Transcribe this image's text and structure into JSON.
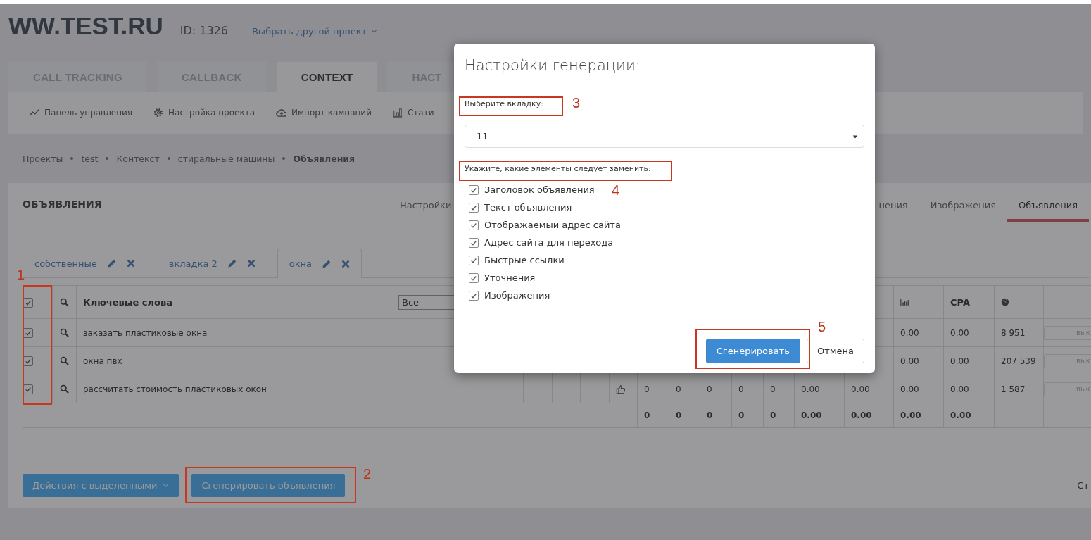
{
  "header": {
    "logo": "WW.TEST.RU",
    "project_id": "ID: 1326",
    "switch_project": "Выбрать другой проект"
  },
  "main_tabs": [
    {
      "label": "CALL TRACKING",
      "selected": false
    },
    {
      "label": "CALLBACK",
      "selected": false
    },
    {
      "label": "CONTEXT",
      "selected": true
    },
    {
      "label": "НАСТ",
      "selected": false
    }
  ],
  "sub_nav": [
    {
      "label": "Панель управления"
    },
    {
      "label": "Настройка проекта"
    },
    {
      "label": "Импорт кампаний"
    },
    {
      "label": "Стати"
    }
  ],
  "breadcrumbs": [
    {
      "label": "Проекты",
      "current": false
    },
    {
      "label": "test",
      "current": false
    },
    {
      "label": "Контекст",
      "current": false
    },
    {
      "label": "стиральные машины",
      "current": false
    },
    {
      "label": "Объявления",
      "current": true
    }
  ],
  "section": {
    "title": "ОБЪЯВЛЕНИЯ",
    "tabs": [
      {
        "label": "Настройки",
        "selected": false
      },
      {
        "label": "нения",
        "selected": false
      },
      {
        "label": "Изображения",
        "selected": false
      },
      {
        "label": "Объявления",
        "selected": true
      }
    ]
  },
  "ad_tabs": [
    {
      "label": "собственные",
      "selected": false
    },
    {
      "label": "вкладка 2",
      "selected": false
    },
    {
      "label": "окна",
      "selected": true
    }
  ],
  "table": {
    "header": {
      "checked": true,
      "title": "Ключевые слова",
      "filter": "Все",
      "stat_headers": [
        {
          "kind": "bars"
        },
        {
          "kind": "text",
          "text": "CPA"
        },
        {
          "kind": "globe"
        }
      ]
    },
    "rows": [
      {
        "checked": true,
        "keyword": "заказать пластиковые окна",
        "thumb": false,
        "stats": [
          "0.00",
          "0.00",
          "8 951"
        ],
        "toggle": {
          "label": "вык",
          "on": false
        }
      },
      {
        "checked": true,
        "keyword": "окна пвх",
        "thumb": false,
        "stats": [
          "0.00",
          "0.00",
          "207 539"
        ],
        "toggle": {
          "label": "вык",
          "on": false
        }
      },
      {
        "checked": true,
        "keyword": "рассчитать стоимость пластиковых окон",
        "thumb": true,
        "stats": [
          "0",
          "0",
          "0",
          "0",
          "0",
          "0.00",
          "0.00",
          "0.00",
          "0.00",
          "1 587"
        ],
        "toggle": {
          "label": "вык",
          "on": false
        }
      }
    ],
    "totals": [
      "0",
      "0",
      "0",
      "0",
      "0",
      "0.00",
      "0.00",
      "0.00",
      "0.00"
    ]
  },
  "actions": {
    "bulk": "Действия с выделенными",
    "generate": "Сгенерировать объявления",
    "pager": "Ст"
  },
  "modal": {
    "title": "Настройки генерации:",
    "tab_label": "Выберите вкладку:",
    "tab_value": "11",
    "elements_label": "Укажите, какие элементы следует заменить:",
    "elements": [
      {
        "label": "Заголовок объявления",
        "checked": true
      },
      {
        "label": "Текст объявления",
        "checked": true
      },
      {
        "label": "Отображаемый адрес сайта",
        "checked": true
      },
      {
        "label": "Адрес сайта для перехода",
        "checked": true
      },
      {
        "label": "Быстрые ссылки",
        "checked": true
      },
      {
        "label": "Уточнения",
        "checked": true
      },
      {
        "label": "Изображения",
        "checked": true
      }
    ],
    "buttons": [
      {
        "label": "Сгенерировать",
        "kind": "primary"
      },
      {
        "label": "Отмена",
        "kind": "default"
      }
    ]
  },
  "annotations": [
    {
      "number": "1"
    },
    {
      "number": "2"
    },
    {
      "number": "3"
    },
    {
      "number": "4"
    },
    {
      "number": "5"
    }
  ]
}
